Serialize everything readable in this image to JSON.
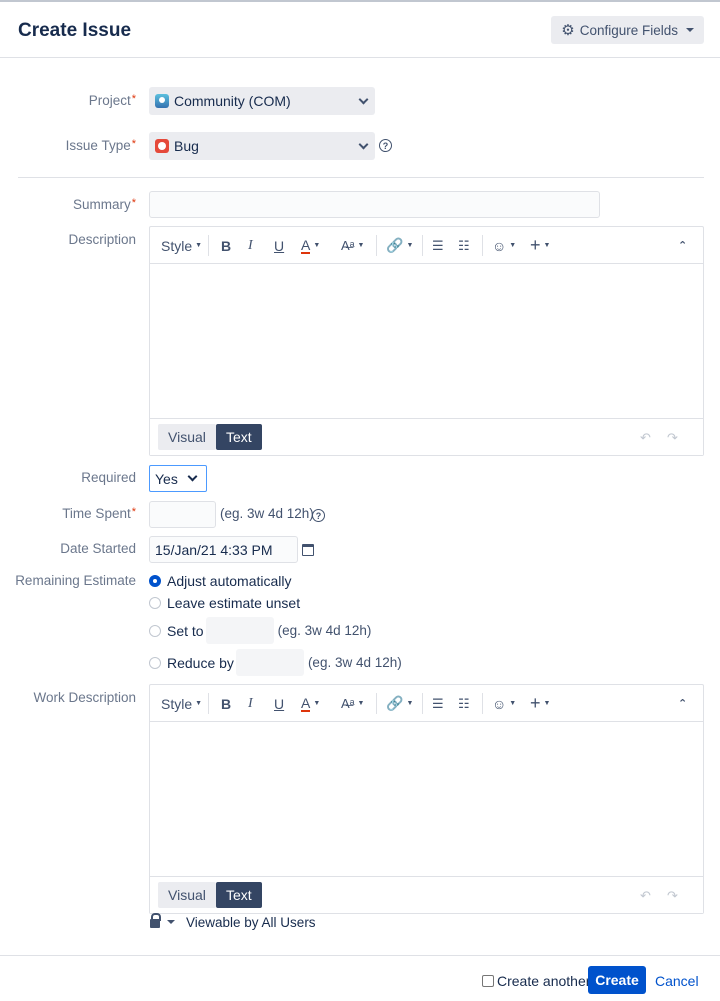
{
  "dialog": {
    "title": "Create Issue",
    "configure_fields": "Configure Fields"
  },
  "fields": {
    "project": {
      "label": "Project",
      "value": "Community (COM)"
    },
    "issue_type": {
      "label": "Issue Type",
      "value": "Bug"
    },
    "summary": {
      "label": "Summary",
      "value": ""
    },
    "description": {
      "label": "Description"
    },
    "required": {
      "label": "Required",
      "value": "Yes"
    },
    "time_spent": {
      "label": "Time Spent",
      "value": "",
      "hint": "(eg. 3w 4d 12h)"
    },
    "date_started": {
      "label": "Date Started",
      "value": "15/Jan/21 4:33 PM"
    },
    "remaining_estimate": {
      "label": "Remaining Estimate",
      "options": {
        "adjust": "Adjust automatically",
        "leave": "Leave estimate unset",
        "set_to": "Set to",
        "reduce_by": "Reduce by"
      },
      "selected": "adjust",
      "set_hint": "(eg. 3w 4d 12h)",
      "reduce_hint": "(eg. 3w 4d 12h)"
    },
    "work_description": {
      "label": "Work Description"
    }
  },
  "editor": {
    "style": "Style",
    "bold": "B",
    "italic": "I",
    "underline": "U",
    "text_color": "A",
    "visual": "Visual",
    "text": "Text"
  },
  "visibility": "Viewable by All Users",
  "footer": {
    "create_another": "Create another",
    "create": "Create",
    "cancel": "Cancel"
  },
  "colors": {
    "primary": "#0052CC",
    "required": "#DE350B",
    "text_mode_active": "#344563"
  }
}
